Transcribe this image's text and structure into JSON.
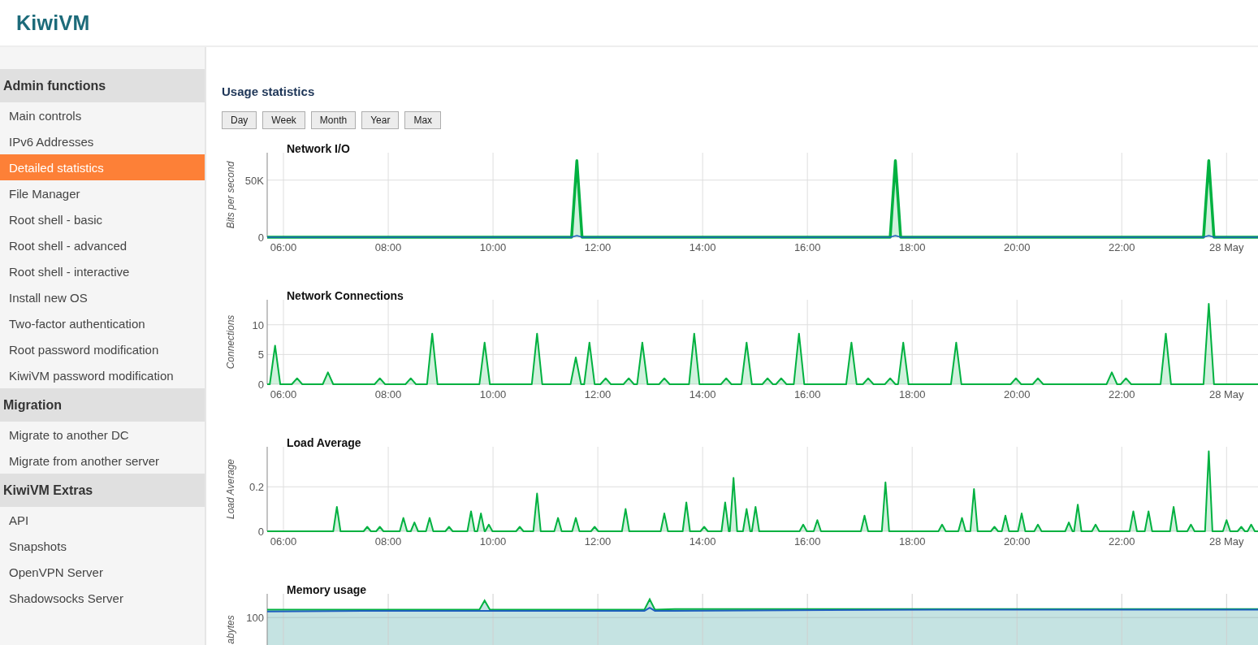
{
  "logo": "KiwiVM",
  "sidebar": {
    "sections": [
      {
        "title": "Admin functions",
        "items": [
          {
            "label": "Main controls",
            "selected": false
          },
          {
            "label": "IPv6 Addresses",
            "selected": false
          },
          {
            "label": "Detailed statistics",
            "selected": true
          },
          {
            "label": "File Manager",
            "selected": false
          },
          {
            "label": "Root shell - basic",
            "selected": false
          },
          {
            "label": "Root shell - advanced",
            "selected": false
          },
          {
            "label": "Root shell - interactive",
            "selected": false
          },
          {
            "label": "Install new OS",
            "selected": false
          },
          {
            "label": "Two-factor authentication",
            "selected": false
          },
          {
            "label": "Root password modification",
            "selected": false
          },
          {
            "label": "KiwiVM password modification",
            "selected": false
          }
        ]
      },
      {
        "title": "Migration",
        "items": [
          {
            "label": "Migrate to another DC",
            "selected": false
          },
          {
            "label": "Migrate from another server",
            "selected": false
          }
        ]
      },
      {
        "title": "KiwiVM Extras",
        "items": [
          {
            "label": "API",
            "selected": false
          },
          {
            "label": "Snapshots",
            "selected": false
          },
          {
            "label": "OpenVPN Server",
            "selected": false
          },
          {
            "label": "Shadowsocks Server",
            "selected": false
          }
        ]
      }
    ]
  },
  "main": {
    "title": "Usage statistics",
    "range_buttons": [
      "Day",
      "Week",
      "Month",
      "Year",
      "Max"
    ],
    "charts": [
      {
        "chart_data": {
          "type": "area",
          "grid": true,
          "title": "Network I/O",
          "ylabel": "Bits per second",
          "x": [
            5.69,
            11.5,
            11.6,
            11.7,
            17.58,
            17.68,
            17.78,
            23.56,
            23.66,
            23.76,
            24.6
          ],
          "series": [
            {
              "color": "#00b140",
              "values": [
                0,
                0,
                67000,
                0,
                0,
                67000,
                0,
                0,
                67000,
                0,
                0
              ]
            },
            {
              "color": "#1f5fbf",
              "values": [
                0,
                0,
                1500,
                0,
                0,
                1500,
                0,
                0,
                1500,
                0,
                0
              ]
            }
          ],
          "xlim": [
            5.69,
            24.6
          ],
          "ylim": [
            0,
            74000
          ],
          "xticks": [
            {
              "value": 6,
              "label": "06:00"
            },
            {
              "value": 8,
              "label": "08:00"
            },
            {
              "value": 10,
              "label": "10:00"
            },
            {
              "value": 12,
              "label": "12:00"
            },
            {
              "value": 14,
              "label": "14:00"
            },
            {
              "value": 16,
              "label": "16:00"
            },
            {
              "value": 18,
              "label": "18:00"
            },
            {
              "value": 20,
              "label": "20:00"
            },
            {
              "value": 22,
              "label": "22:00"
            },
            {
              "value": 24,
              "label": "28 May"
            }
          ],
          "yticks": [
            0,
            {
              "value": 50000,
              "label": "50K"
            }
          ]
        }
      },
      {
        "chart_data": {
          "type": "area",
          "grid": true,
          "title": "Network Connections",
          "ylabel": "Connections",
          "x": [
            5.69,
            5.74,
            5.84,
            5.94,
            6.16,
            6.26,
            6.36,
            6.75,
            6.85,
            6.95,
            7.74,
            7.84,
            7.94,
            8.33,
            8.43,
            8.53,
            8.74,
            8.84,
            8.94,
            9.74,
            9.84,
            9.94,
            10.74,
            10.84,
            10.94,
            11.48,
            11.58,
            11.68,
            11.74,
            11.84,
            11.94,
            12.05,
            12.15,
            12.25,
            12.49,
            12.59,
            12.69,
            12.75,
            12.85,
            12.95,
            13.17,
            13.27,
            13.37,
            13.74,
            13.84,
            13.94,
            14.35,
            14.45,
            14.55,
            14.74,
            14.84,
            14.94,
            15.14,
            15.24,
            15.34,
            15.4,
            15.5,
            15.6,
            15.74,
            15.84,
            15.94,
            16.74,
            16.84,
            16.94,
            17.06,
            17.16,
            17.26,
            17.48,
            17.58,
            17.68,
            17.73,
            17.83,
            17.93,
            18.74,
            18.84,
            18.94,
            19.88,
            19.98,
            20.08,
            20.3,
            20.4,
            20.5,
            21.71,
            21.81,
            21.91,
            21.98,
            22.08,
            22.18,
            22.74,
            22.84,
            22.94,
            23.56,
            23.66,
            23.76,
            24.6
          ],
          "series": [
            {
              "color": "#00b140",
              "values": [
                0,
                0,
                6.5,
                0,
                0,
                1,
                0,
                0,
                2,
                0,
                0,
                1,
                0,
                0,
                1,
                0,
                0,
                8.5,
                0,
                0,
                7,
                0,
                0,
                8.5,
                0,
                0,
                4.5,
                0,
                0,
                7,
                0,
                0,
                1,
                0,
                0,
                1,
                0,
                0,
                7,
                0,
                0,
                1,
                0,
                0,
                8.5,
                0,
                0,
                1,
                0,
                0,
                7,
                0,
                0,
                1,
                0,
                0,
                1,
                0,
                0,
                8.5,
                0,
                0,
                7,
                0,
                0,
                1,
                0,
                0,
                1,
                0,
                0,
                7,
                0,
                0,
                7,
                0,
                0,
                1,
                0,
                0,
                1,
                0,
                0,
                2,
                0,
                0,
                1,
                0,
                0,
                8.5,
                0,
                0,
                13.5,
                0,
                0
              ]
            }
          ],
          "xlim": [
            5.69,
            24.6
          ],
          "ylim": [
            0,
            14.2
          ],
          "xticks": [
            {
              "value": 6,
              "label": "06:00"
            },
            {
              "value": 8,
              "label": "08:00"
            },
            {
              "value": 10,
              "label": "10:00"
            },
            {
              "value": 12,
              "label": "12:00"
            },
            {
              "value": 14,
              "label": "14:00"
            },
            {
              "value": 16,
              "label": "16:00"
            },
            {
              "value": 18,
              "label": "18:00"
            },
            {
              "value": 20,
              "label": "20:00"
            },
            {
              "value": 22,
              "label": "22:00"
            },
            {
              "value": 24,
              "label": "28 May"
            }
          ],
          "yticks": [
            0,
            5,
            10
          ]
        }
      },
      {
        "chart_data": {
          "type": "area",
          "grid": true,
          "title": "Load Average",
          "ylabel": "Load Average",
          "x": [
            5.69,
            6.95,
            7.02,
            7.09,
            7.53,
            7.6,
            7.67,
            7.77,
            7.84,
            7.91,
            8.22,
            8.29,
            8.36,
            8.43,
            8.5,
            8.57,
            8.72,
            8.79,
            8.86,
            9.09,
            9.16,
            9.23,
            9.51,
            9.58,
            9.65,
            9.7,
            9.77,
            9.84,
            9.85,
            9.92,
            9.99,
            10.44,
            10.51,
            10.58,
            10.77,
            10.84,
            10.91,
            11.17,
            11.24,
            11.31,
            11.51,
            11.58,
            11.65,
            11.87,
            11.94,
            12.01,
            12.46,
            12.53,
            12.6,
            13.2,
            13.27,
            13.34,
            13.62,
            13.69,
            13.76,
            13.96,
            14.03,
            14.1,
            14.36,
            14.43,
            14.5,
            14.52,
            14.59,
            14.66,
            14.77,
            14.84,
            14.91,
            14.94,
            15.01,
            15.08,
            15.85,
            15.92,
            15.99,
            16.12,
            16.19,
            16.26,
            17.02,
            17.09,
            17.16,
            17.42,
            17.49,
            17.56,
            18.5,
            18.57,
            18.64,
            18.88,
            18.95,
            19.02,
            19.11,
            19.18,
            19.25,
            19.5,
            19.57,
            19.64,
            19.71,
            19.78,
            19.85,
            20.02,
            20.09,
            20.16,
            20.33,
            20.4,
            20.47,
            20.92,
            20.99,
            21.06,
            21.09,
            21.16,
            21.23,
            21.43,
            21.5,
            21.57,
            22.15,
            22.22,
            22.29,
            22.44,
            22.51,
            22.58,
            22.92,
            22.99,
            23.06,
            23.25,
            23.32,
            23.39,
            23.59,
            23.66,
            23.73,
            23.93,
            24.0,
            24.07,
            24.21,
            24.28,
            24.35,
            24.4,
            24.47,
            24.54,
            24.6
          ],
          "series": [
            {
              "color": "#00b140",
              "values": [
                0,
                0,
                0.11,
                0,
                0,
                0.02,
                0,
                0,
                0.02,
                0,
                0,
                0.06,
                0,
                0,
                0.04,
                0,
                0,
                0.06,
                0,
                0,
                0.02,
                0,
                0,
                0.09,
                0,
                0,
                0.08,
                0,
                0,
                0.03,
                0,
                0,
                0.02,
                0,
                0,
                0.17,
                0,
                0,
                0.06,
                0,
                0,
                0.06,
                0,
                0,
                0.02,
                0,
                0,
                0.1,
                0,
                0,
                0.08,
                0,
                0,
                0.13,
                0,
                0,
                0.02,
                0,
                0,
                0.13,
                0,
                0,
                0.24,
                0,
                0,
                0.1,
                0,
                0,
                0.11,
                0,
                0,
                0.03,
                0,
                0,
                0.05,
                0,
                0,
                0.07,
                0,
                0,
                0.22,
                0,
                0,
                0.03,
                0,
                0,
                0.06,
                0,
                0,
                0.19,
                0,
                0,
                0.02,
                0,
                0,
                0.07,
                0,
                0,
                0.08,
                0,
                0,
                0.03,
                0,
                0,
                0.04,
                0,
                0,
                0.12,
                0,
                0,
                0.03,
                0,
                0,
                0.09,
                0,
                0,
                0.09,
                0,
                0,
                0.11,
                0,
                0,
                0.03,
                0,
                0,
                0.36,
                0,
                0,
                0.05,
                0,
                0,
                0.02,
                0,
                0,
                0.03,
                0,
                0
              ]
            }
          ],
          "xlim": [
            5.69,
            24.6
          ],
          "ylim": [
            0,
            0.38
          ],
          "xticks": [
            {
              "value": 6,
              "label": "06:00"
            },
            {
              "value": 8,
              "label": "08:00"
            },
            {
              "value": 10,
              "label": "10:00"
            },
            {
              "value": 12,
              "label": "12:00"
            },
            {
              "value": 14,
              "label": "14:00"
            },
            {
              "value": 16,
              "label": "16:00"
            },
            {
              "value": 18,
              "label": "18:00"
            },
            {
              "value": 20,
              "label": "20:00"
            },
            {
              "value": 22,
              "label": "22:00"
            },
            {
              "value": 24,
              "label": "28 May"
            }
          ],
          "yticks": [
            0,
            0.2
          ]
        }
      },
      {
        "kind": "picture",
        "title": "Memory usage",
        "ylabel": "abytes",
        "tick_label": "100"
      }
    ]
  }
}
